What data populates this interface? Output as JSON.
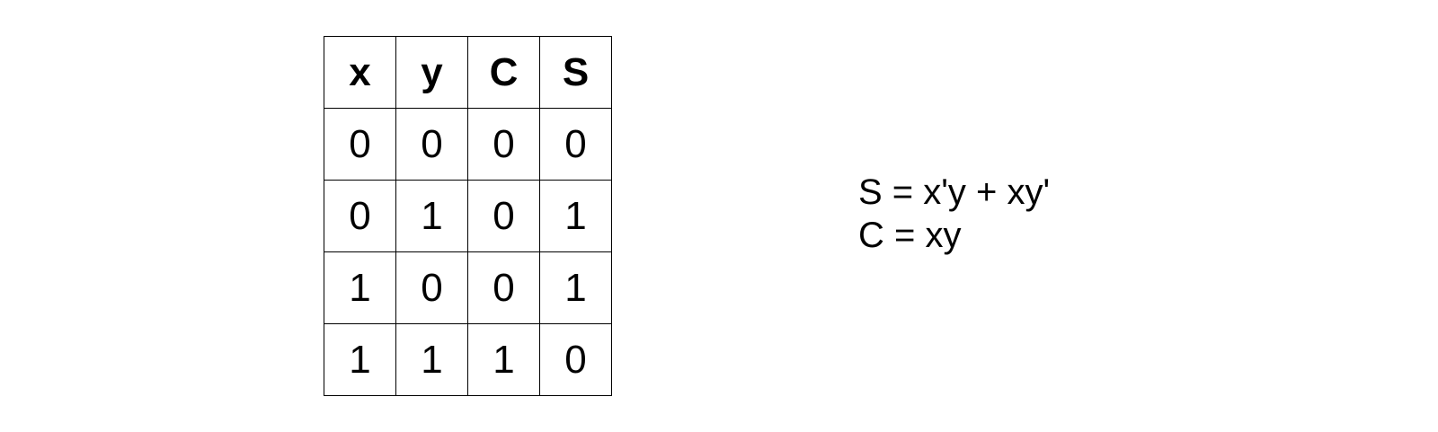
{
  "truth_table": {
    "headers": [
      "x",
      "y",
      "C",
      "S"
    ],
    "rows": [
      [
        "0",
        "0",
        "0",
        "0"
      ],
      [
        "0",
        "1",
        "0",
        "1"
      ],
      [
        "1",
        "0",
        "0",
        "1"
      ],
      [
        "1",
        "1",
        "1",
        "0"
      ]
    ]
  },
  "equations": {
    "sum": "S = x'y + xy'",
    "carry": "C = xy"
  }
}
